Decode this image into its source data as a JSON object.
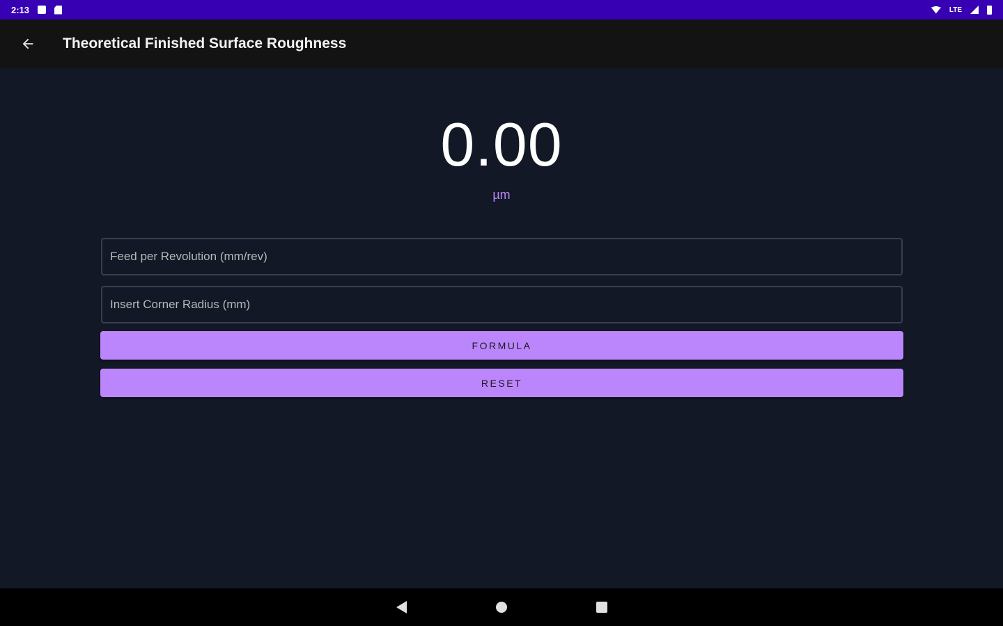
{
  "status_bar": {
    "time": "2:13",
    "icons_left": [
      "notification-icon",
      "sd-card-icon"
    ],
    "network": "LTE",
    "icons_right": [
      "wifi-icon",
      "signal-icon",
      "battery-icon"
    ]
  },
  "app_bar": {
    "back_icon": "arrow-left-icon",
    "title": "Theoretical Finished Surface Roughness"
  },
  "result": {
    "value": "0.00",
    "unit": "µm"
  },
  "form": {
    "feed_placeholder": "Feed per Revolution (mm/rev)",
    "feed_value": "",
    "radius_placeholder": "Insert Corner Radius (mm)",
    "radius_value": "",
    "formula_label": "FORMULA",
    "reset_label": "RESET"
  },
  "nav_bar": {
    "buttons": [
      "back-triangle-icon",
      "home-circle-icon",
      "recents-square-icon"
    ]
  },
  "colors": {
    "status_bar": "#3700b3",
    "app_bar": "#131313",
    "background": "#121826",
    "accent": "#bb86fc",
    "nav_bar": "#000000"
  }
}
